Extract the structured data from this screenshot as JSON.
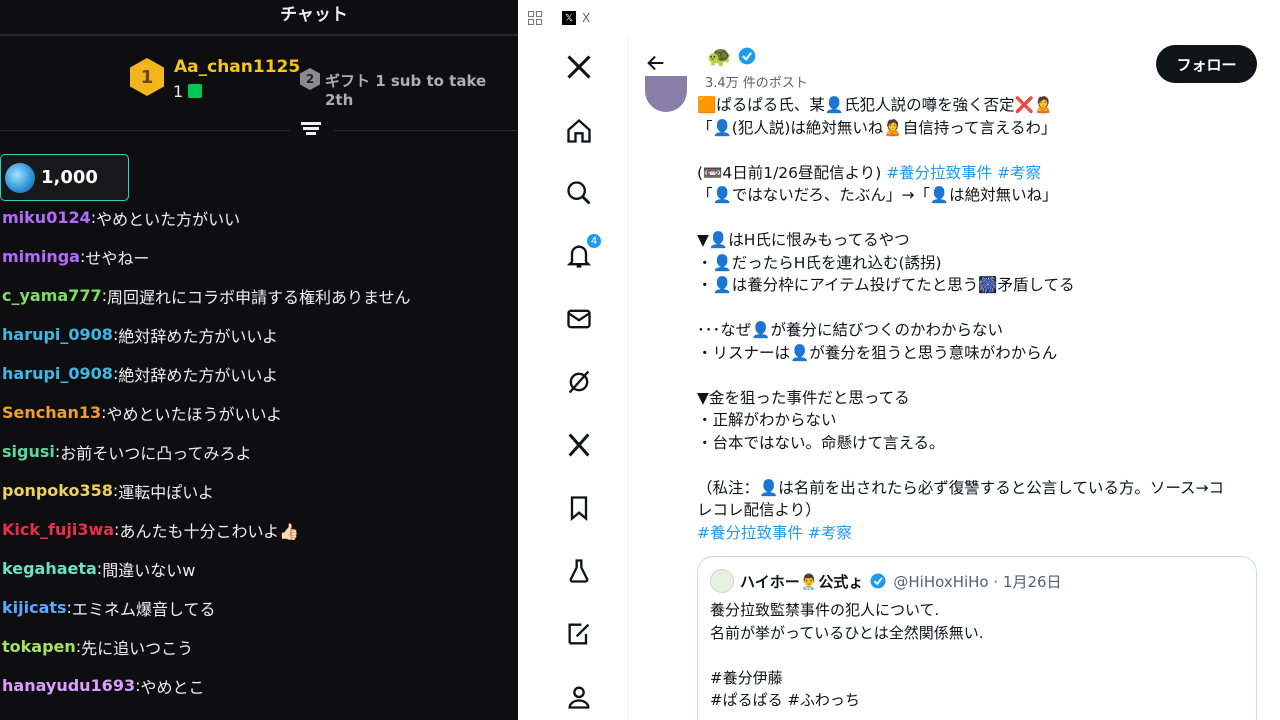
{
  "chat": {
    "title": "チャット",
    "leaderboard": {
      "rank1_number": "1",
      "rank1_name": "Aa_chan1125",
      "rank1_count": "1",
      "rank2_number": "2",
      "rank2_text": "ギフト 1 sub to take 2th"
    },
    "coin_value": "1,000",
    "messages": [
      {
        "user": "miku0124",
        "text": "やめといた方がいい",
        "color": "#b36bff"
      },
      {
        "user": "miminga",
        "text": "せやねー",
        "color": "#b36bff"
      },
      {
        "user": "c_yama777",
        "text": "周回遅れにコラボ申請する権利ありません",
        "color": "#7be060"
      },
      {
        "user": "harupi_0908",
        "text": "絶対辞めた方がいいよ",
        "color": "#3fb8e6"
      },
      {
        "user": "harupi_0908",
        "text": "絶対辞めた方がいいよ",
        "color": "#3fb8e6"
      },
      {
        "user": "Senchan13",
        "text": "やめといたほうがいいよ",
        "color": "#f0a030"
      },
      {
        "user": "sigusi",
        "text": "お前そいつに凸ってみろよ",
        "color": "#5cd6a6"
      },
      {
        "user": "ponpoko358",
        "text": "運転中ぽいよ",
        "color": "#f0d060"
      },
      {
        "user": "Kick_fuji3wa",
        "text": "あんたも十分こわいよ👍🏻",
        "color": "#e8304a"
      },
      {
        "user": "kegahaeta",
        "text": "間違いないw",
        "color": "#6fe0c8"
      },
      {
        "user": "kijicats",
        "text": "エミネム爆音してる",
        "color": "#5ca8ff"
      },
      {
        "user": "tokapen",
        "text": "先に追いつこう",
        "color": "#a8e060"
      },
      {
        "user": "hanayudu1693",
        "text": "やめとこ",
        "color": "#d8a0ff"
      }
    ]
  },
  "x": {
    "tab_title": "X",
    "notif_count": "4",
    "profile_emoji": "🐢",
    "post_count": "3.4万 件のポスト",
    "follow_label": "フォロー",
    "tweet_lines": [
      {
        "text": "🟧ぱるぱる氏、某👤氏犯人説の噂を強く否定❌🙎",
        "hash": ""
      },
      {
        "text": "「👤(犯人説)は絶対無いね🙎自信持って言えるわ」",
        "hash": ""
      },
      {
        "text": "",
        "hash": ""
      },
      {
        "text": "(📼4日前1/26昼配信より) ",
        "hash": "#養分拉致事件 #考察"
      },
      {
        "text": "「👤ではないだろ、たぶん」→「👤は絶対無いね」",
        "hash": ""
      },
      {
        "text": "",
        "hash": ""
      },
      {
        "text": "▼👤はH氏に恨みもってるやつ",
        "hash": ""
      },
      {
        "text": "・👤だったらH氏を連れ込む(誘拐)",
        "hash": ""
      },
      {
        "text": "・👤は養分枠にアイテム投げてたと思う🎆矛盾してる",
        "hash": ""
      },
      {
        "text": "",
        "hash": ""
      },
      {
        "text": "･･･なぜ👤が養分に結びつくのかわからない",
        "hash": ""
      },
      {
        "text": "・リスナーは👤が養分を狙うと思う意味がわからん",
        "hash": ""
      },
      {
        "text": "",
        "hash": ""
      },
      {
        "text": "▼金を狙った事件だと思ってる",
        "hash": ""
      },
      {
        "text": "・正解がわからない",
        "hash": ""
      },
      {
        "text": "・台本ではない。命懸けて言える。",
        "hash": ""
      },
      {
        "text": "",
        "hash": ""
      },
      {
        "text": "（私注：👤は名前を出されたら必ず復讐すると公言している方。ソース→コ",
        "hash": ""
      },
      {
        "text": "レコレ配信より）",
        "hash": ""
      },
      {
        "text": "",
        "hash": "#養分拉致事件 #考察"
      }
    ],
    "quote": {
      "name": "ハイホー👨‍⚕️公式ょ",
      "handle": "@HiHoxHiHo · 1月26日",
      "lines": [
        "養分拉致監禁事件の犯人について.",
        "名前が挙がっているひとは全然関係無い.",
        "",
        "#養分伊藤",
        "#ぱるぱる #ふわっち"
      ]
    }
  }
}
